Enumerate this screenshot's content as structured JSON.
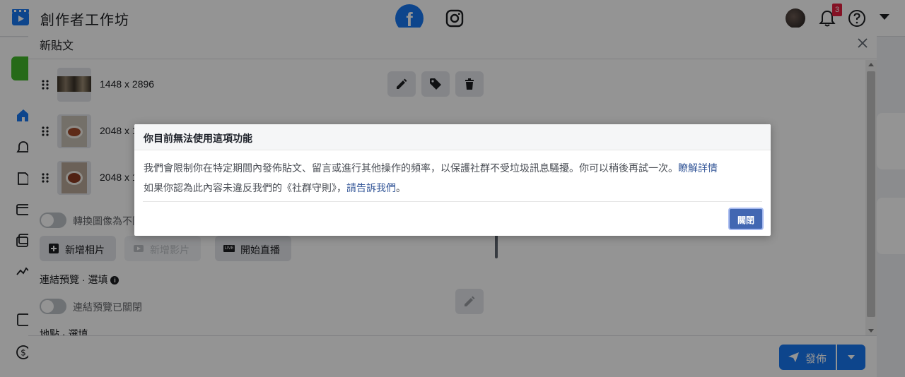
{
  "app": {
    "title": "創作者工作坊",
    "notification_count": "3"
  },
  "composer": {
    "title": "新貼文",
    "media": [
      {
        "dims": "1448 x 2896"
      },
      {
        "dims": "2048 x 1"
      },
      {
        "dims": "2048 x 1"
      }
    ],
    "convert_toggle_label": "轉換圖像為不同",
    "add_photo_label": "新增相片",
    "add_video_label": "新增影片",
    "go_live_label": "開始直播",
    "go_live_icon_text": "LIVE",
    "link_preview_section": "連結預覽 · 選填",
    "link_preview_toggle_label": "連結預覽已關閉",
    "location_section": "地點 · 選填",
    "publish_label": "發佈"
  },
  "dialog": {
    "title": "你目前無法使用這項功能",
    "line1_text": "我們會限制你在特定期間內發佈貼文、留言或進行其他操作的頻率，以保護社群不受垃圾訊息騷擾。你可以稍後再試一次。",
    "line1_link": "瞭解詳情",
    "line2_text": "如果你認為此內容未違反我們的《社群守則》，",
    "line2_link": "請告訴我們",
    "line2_end": "。",
    "close_label": "關閉"
  },
  "colors": {
    "facebook_blue": "#1877f2",
    "dialog_button": "#4267b2",
    "link": "#365899",
    "badge_red": "#e41e3f"
  }
}
